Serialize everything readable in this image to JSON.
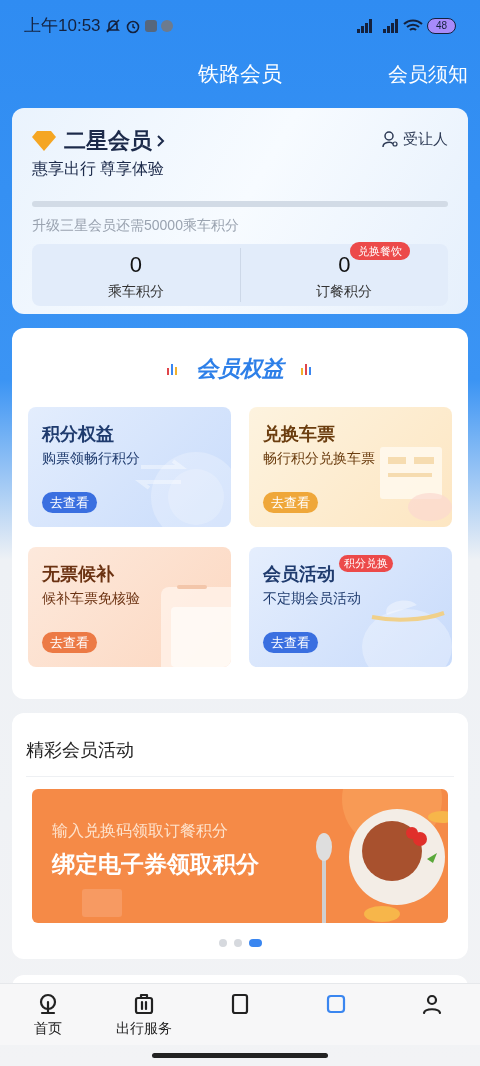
{
  "status_bar": {
    "time": "上午10:53",
    "battery": "48"
  },
  "header": {
    "title": "铁路会员",
    "action": "会员须知"
  },
  "member": {
    "level_name": "二星会员",
    "slogan": "惠享出行 尊享体验",
    "beneficiary": "受让人",
    "progress": {
      "level": 0
    },
    "upgrade_hint": "升级三星会员还需50000乘车积分",
    "points": [
      {
        "value": "0",
        "label": "乘车积分"
      },
      {
        "value": "0",
        "label": "订餐积分",
        "badge": "兑换餐饮"
      }
    ]
  },
  "benefits": {
    "title": "会员权益",
    "cards": [
      {
        "title": "积分权益",
        "subtitle": "购票领畅行积分",
        "button": "去查看",
        "color": "#3a6fe0"
      },
      {
        "title": "兑换车票",
        "subtitle": "畅行积分兑换车票",
        "button": "去查看",
        "color": "#efa73a"
      },
      {
        "title": "无票候补",
        "subtitle": "候补车票免核验",
        "button": "去查看",
        "color": "#ec7a45"
      },
      {
        "title": "会员活动",
        "subtitle": "不定期会员活动",
        "button": "去查看",
        "color": "#3a6fe0",
        "badge": "积分兑换"
      }
    ]
  },
  "activities": {
    "title": "精彩会员活动",
    "banner": {
      "line1": "输入兑换码领取订餐积分",
      "line2": "绑定电子券领取积分"
    },
    "dots": [
      {
        "selected": false
      },
      {
        "selected": false
      },
      {
        "selected": true
      }
    ]
  },
  "bottom_nav": [
    {
      "label": "首页",
      "selected": false,
      "kind": "home"
    },
    {
      "label": "出行服务",
      "selected": false,
      "kind": "luggage"
    },
    {
      "selected": false,
      "kind": "ticket"
    },
    {
      "selected": true,
      "kind": "member"
    },
    {
      "selected": false,
      "kind": "user"
    }
  ]
}
